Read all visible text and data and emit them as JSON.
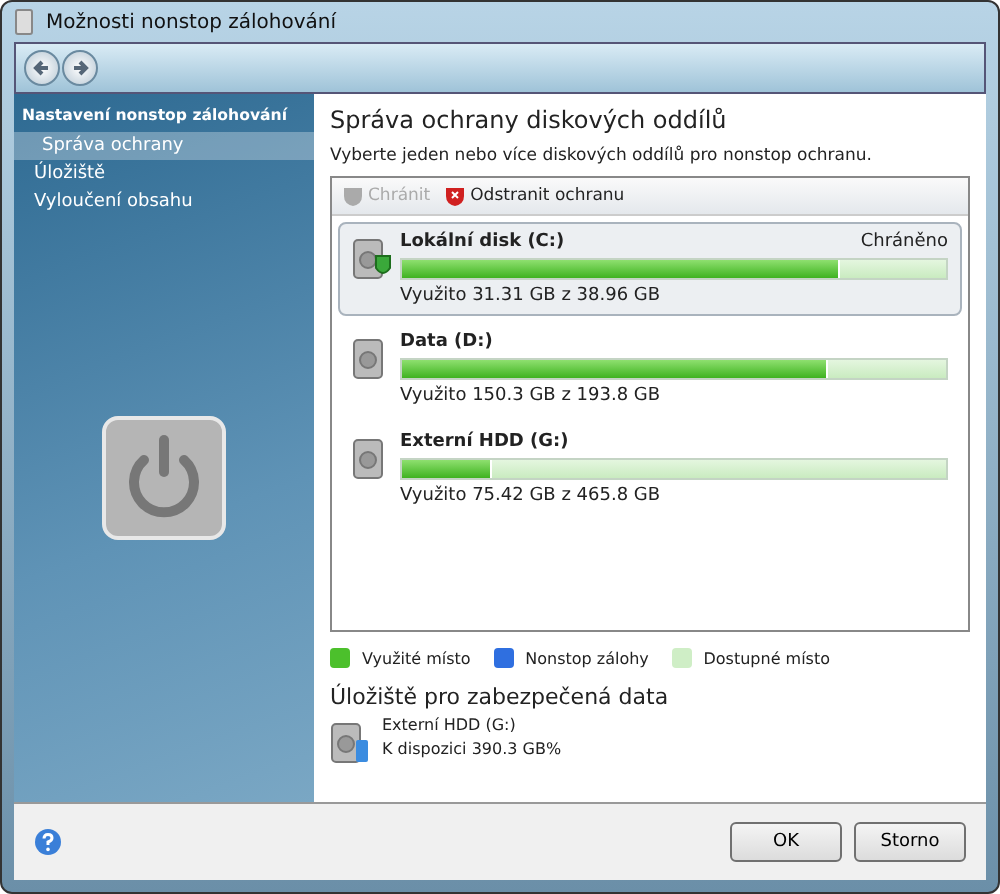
{
  "window": {
    "title": "Možnosti nonstop zálohování"
  },
  "sidebar": {
    "heading": "Nastavení nonstop zálohování",
    "items": [
      {
        "label": "Správa ochrany",
        "selected": true
      },
      {
        "label": "Úložiště",
        "selected": false
      },
      {
        "label": "Vyloučení obsahu",
        "selected": false
      }
    ]
  },
  "main": {
    "title": "Správa ochrany diskových oddílů",
    "subtitle": "Vyberte jeden nebo více diskových oddílů pro nonstop ochranu.",
    "toolbar": [
      {
        "label": "Chránit",
        "disabled": true
      },
      {
        "label": "Odstranit ochranu",
        "disabled": false
      }
    ],
    "disks": [
      {
        "name": "Lokální disk (C:)",
        "status": "Chráněno",
        "protected": true,
        "selected": true,
        "level": 0.8,
        "usage": "Využito 31.31 GB z 38.96 GB"
      },
      {
        "name": "Data (D:)",
        "protected": false,
        "selected": false,
        "level": 0.78,
        "usage": "Využito 150.3 GB z 193.8 GB"
      },
      {
        "name": "Externí HDD (G:)",
        "protected": false,
        "selected": false,
        "level": 0.16,
        "usage": "Využito 75.42 GB z 465.8 GB"
      }
    ],
    "legend": [
      {
        "label": "Využité místo",
        "color": "#4cc02c"
      },
      {
        "label": "Nonstop zálohy",
        "color": "#2f6fe0"
      },
      {
        "label": "Dostupné místo",
        "color": "#cfeec6"
      }
    ],
    "storage": {
      "title": "Úložiště pro zabezpečená data",
      "name": "Externí HDD (G:)",
      "available": "K dispozici 390.3 GB%"
    }
  },
  "buttons": [
    {
      "label": "OK"
    },
    {
      "label": "Storno"
    }
  ]
}
